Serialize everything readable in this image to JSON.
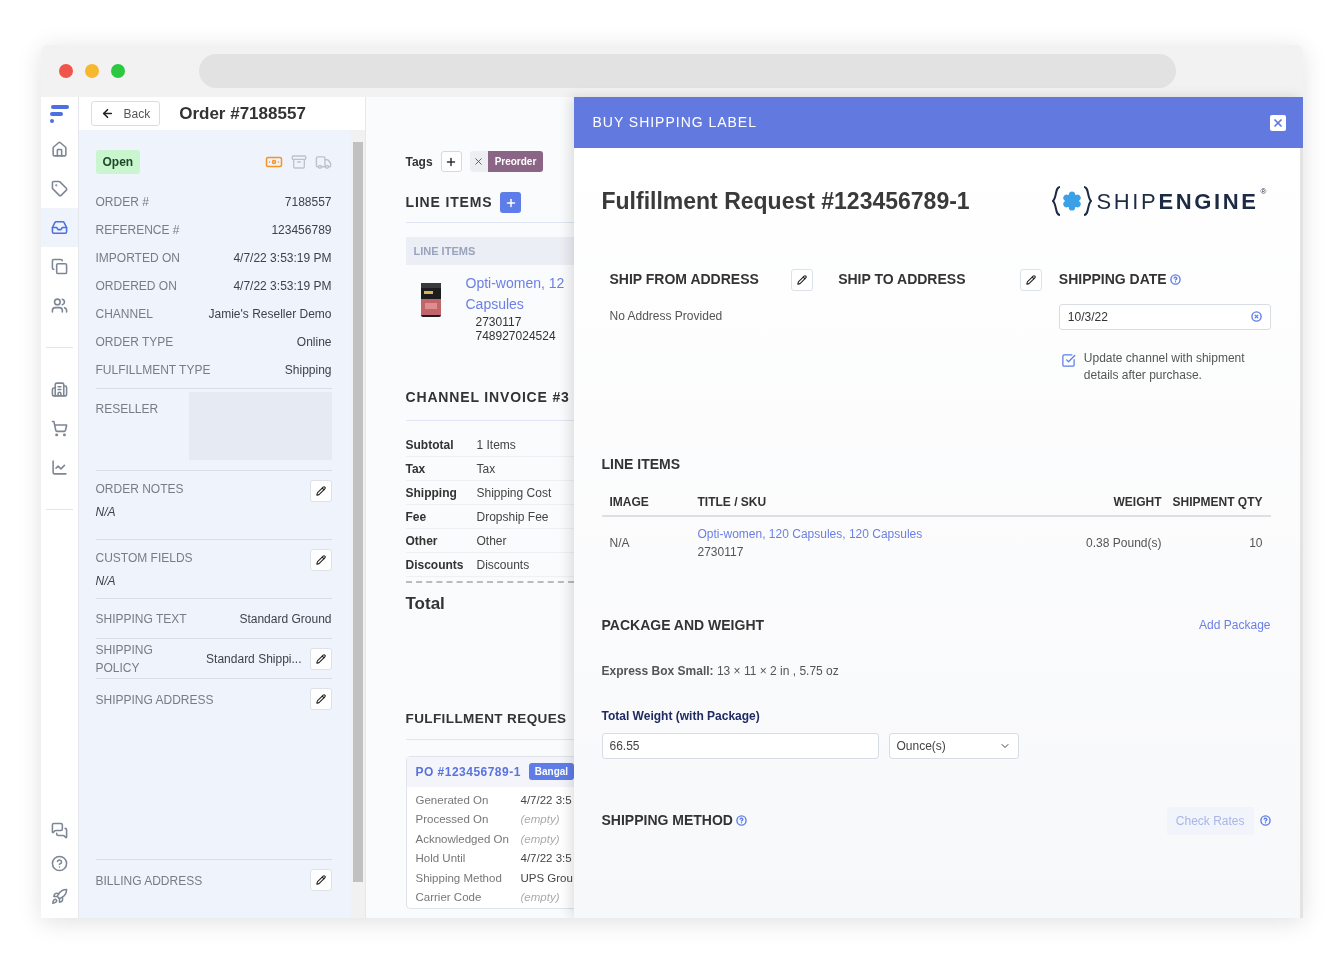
{
  "nav": {
    "main": [
      {
        "selected": false
      },
      {
        "selected": false
      },
      {
        "selected": true
      },
      {
        "selected": false
      },
      {
        "selected": false
      },
      {
        "selected": false
      },
      {
        "selected": false
      },
      {
        "selected": false
      }
    ],
    "footer": [
      {
        "selected": false
      },
      {
        "selected": false
      },
      {
        "selected": false
      }
    ]
  },
  "header": {
    "back": "Back",
    "title": "Order #7188557"
  },
  "order": {
    "status": "Open",
    "details": [
      {
        "label": "ORDER #",
        "value": "7188557"
      },
      {
        "label": "REFERENCE #",
        "value": "123456789"
      },
      {
        "label": "IMPORTED ON",
        "value": "4/7/22 3:53:19 PM"
      },
      {
        "label": "ORDERED ON",
        "value": "4/7/22 3:53:19 PM"
      },
      {
        "label": "CHANNEL",
        "value": "Jamie's Reseller Demo"
      },
      {
        "label": "ORDER TYPE",
        "value": "Online"
      },
      {
        "label": "FULFILLMENT TYPE",
        "value": "Shipping"
      }
    ],
    "reseller": "RESELLER",
    "sections": [
      {
        "kind": "note",
        "label": "ORDER NOTES",
        "value": "N/A",
        "editable": true
      },
      {
        "kind": "note",
        "label": "CUSTOM FIELDS",
        "value": "N/A",
        "editable": true
      },
      {
        "kind": "pair",
        "label": "SHIPPING TEXT",
        "value": "Standard Ground",
        "editable": false
      },
      {
        "kind": "pair",
        "label": "SHIPPING POLICY",
        "value": "Standard Shippi...",
        "editable": true
      },
      {
        "kind": "address",
        "label": "SHIPPING ADDRESS",
        "editable": true
      },
      {
        "kind": "address",
        "label": "BILLING ADDRESS",
        "editable": true
      }
    ]
  },
  "middle": {
    "tags": {
      "label": "Tags",
      "items": [
        "Preorder"
      ]
    },
    "line_items": {
      "title": "LINE ITEMS",
      "header": "LINE ITEMS",
      "items": [
        {
          "title_lines": [
            "Opti-women, 12",
            "Capsules"
          ],
          "codes": [
            "2730117",
            "748927024524"
          ]
        }
      ]
    },
    "invoice": {
      "title": "CHANNEL INVOICE #3",
      "rows": [
        {
          "label": "Subtotal",
          "value": "1 Items"
        },
        {
          "label": "Tax",
          "value": "Tax"
        },
        {
          "label": "Shipping",
          "value": "Shipping Cost"
        },
        {
          "label": "Fee",
          "value": "Dropship Fee"
        },
        {
          "label": "Other",
          "value": "Other"
        },
        {
          "label": "Discounts",
          "value": "Discounts"
        }
      ],
      "total": "Total"
    },
    "fulfillment": {
      "title": "FULFILLMENT REQUES",
      "po": "PO #123456789-1",
      "badge": "Bangal",
      "rows": [
        {
          "label": "Generated On",
          "value": "4/7/22 3:5",
          "muted": false
        },
        {
          "label": "Processed On",
          "value": "(empty)",
          "muted": true
        },
        {
          "label": "Acknowledged On",
          "value": "(empty)",
          "muted": true
        },
        {
          "label": "Hold Until",
          "value": "4/7/22 3:5",
          "muted": false
        },
        {
          "label": "Shipping Method",
          "value": "UPS Grou",
          "muted": false
        },
        {
          "label": "Carrier Code",
          "value": "(empty)",
          "muted": true
        }
      ]
    }
  },
  "modal": {
    "title": "BUY SHIPPING LABEL",
    "heading": "Fulfillment Request #123456789-1",
    "logo": {
      "light": "SHIP",
      "bold": "ENGINE",
      "mark": "®"
    },
    "addresses": [
      {
        "label": "SHIP FROM ADDRESS",
        "value": "No Address Provided"
      },
      {
        "label": "SHIP TO ADDRESS"
      }
    ],
    "shipping_date": {
      "label": "SHIPPING DATE",
      "value": "10/3/22"
    },
    "update_channel": {
      "label": "Update channel with shipment details after purchase.",
      "checked": true
    },
    "line_items": {
      "title": "LINE ITEMS",
      "columns": [
        "IMAGE",
        "TITLE / SKU",
        "WEIGHT",
        "SHIPMENT QTY"
      ],
      "rows": [
        {
          "image": "N/A",
          "title": "Opti-women, 120 Capsules, 120 Capsules",
          "sku": "2730117",
          "weight": "0.38 Pound(s)",
          "qty": "10"
        }
      ]
    },
    "package": {
      "title": "PACKAGE AND WEIGHT",
      "add": "Add Package",
      "box": "**Express Box Small:** 13 × 11 × 2 in , 5.75 oz",
      "weight_label": "Total Weight (with Package)",
      "weight": "66.55",
      "unit": "Ounce(s)"
    },
    "shipping_method": {
      "title": "SHIPPING METHOD",
      "button": "Check Rates",
      "disabled": true
    }
  }
}
